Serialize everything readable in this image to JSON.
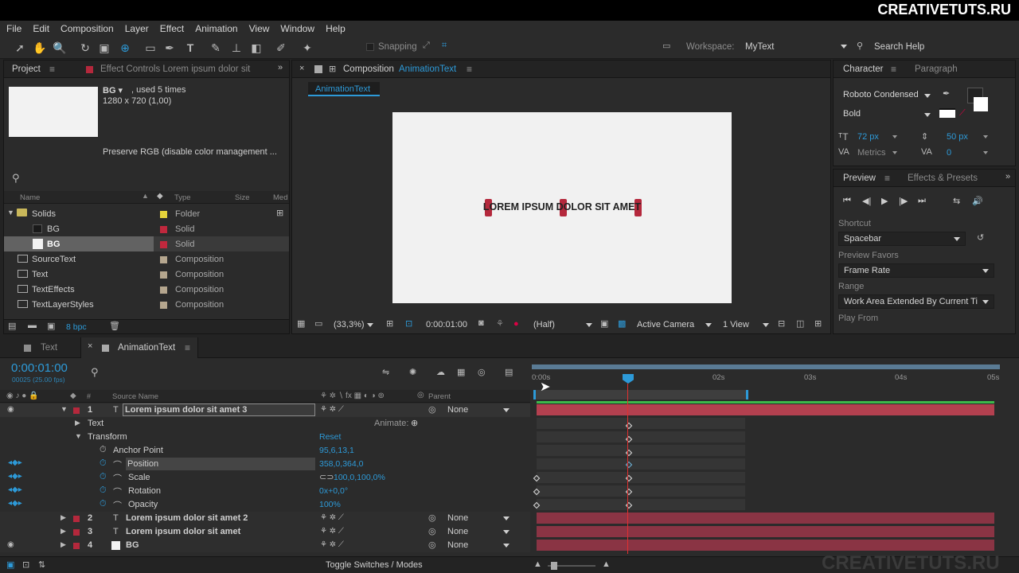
{
  "brand": "CREATIVETUTS.RU",
  "watermark": "CREATIVETUTS.RU",
  "menu": [
    "File",
    "Edit",
    "Composition",
    "Layer",
    "Effect",
    "Animation",
    "View",
    "Window",
    "Help"
  ],
  "toolbar": {
    "snapping": "Snapping",
    "workspace_label": "Workspace:",
    "workspace_value": "MyText",
    "search_help": "Search Help"
  },
  "project": {
    "tab": "Project",
    "effect_controls_tab": "Effect Controls Lorem ipsum dolor sit",
    "item_name": "BG ▾",
    "used": ", used 5 times",
    "dims": "1280 x 720 (1,00)",
    "preserve": "Preserve RGB (disable color management ...",
    "col_name": "Name",
    "col_type": "Type",
    "col_size": "Size",
    "col_med": "Med",
    "items": [
      {
        "name": "Solids",
        "type": "Folder",
        "color": "#e5d33b"
      },
      {
        "name": "BG",
        "type": "Solid",
        "color": "#c0283d"
      },
      {
        "name": "BG",
        "type": "Solid",
        "color": "#c0283d"
      },
      {
        "name": "SourceText",
        "type": "Composition",
        "color": "#b5a68e"
      },
      {
        "name": "Text",
        "type": "Composition",
        "color": "#b5a68e"
      },
      {
        "name": "TextEffects",
        "type": "Composition",
        "color": "#b5a68e"
      },
      {
        "name": "TextLayerStyles",
        "type": "Composition",
        "color": "#b5a68e"
      }
    ],
    "bpc": "8 bpc"
  },
  "comp": {
    "label": "Composition",
    "name": "AnimationText",
    "subtab": "AnimationText",
    "canvas_text": "LOREM IPSUM DOLOR SIT AMET",
    "zoom": "(33,3%)",
    "timecode": "0:00:01:00",
    "resolution": "(Half)",
    "camera": "Active Camera",
    "views": "1 View"
  },
  "character": {
    "tab": "Character",
    "tab2": "Paragraph",
    "font": "Roboto Condensed",
    "style": "Bold",
    "size": "72 px",
    "leading": "50 px",
    "kerning": "Metrics",
    "tracking": "0"
  },
  "preview": {
    "tab": "Preview",
    "tab2": "Effects & Presets",
    "shortcut_label": "Shortcut",
    "shortcut": "Spacebar",
    "favors_label": "Preview Favors",
    "favors": "Frame Rate",
    "range_label": "Range",
    "range": "Work Area Extended By Current Ti",
    "play_from": "Play From"
  },
  "timeline": {
    "tab_text": "Text",
    "tab_anim": "AnimationText",
    "timecode": "0:00:01:00",
    "fps": "00025 (25.00 fps)",
    "col_source": "Source Name",
    "col_parent": "Parent",
    "ruler": [
      "0:00s",
      "02s",
      "03s",
      "04s",
      "05s"
    ],
    "toggle": "Toggle Switches / Modes",
    "layers": [
      {
        "num": "1",
        "name": "Lorem ipsum dolor sit amet 3",
        "parent": "None"
      },
      {
        "num": "2",
        "name": "Lorem ipsum dolor sit amet 2",
        "parent": "None"
      },
      {
        "num": "3",
        "name": "Lorem ipsum dolor sit amet",
        "parent": "None"
      },
      {
        "num": "4",
        "name": "BG",
        "parent": "None"
      }
    ],
    "props": {
      "text": "Text",
      "animate": "Animate:",
      "transform": "Transform",
      "reset": "Reset",
      "anchor": "Anchor Point",
      "anchor_val": "95,6,13,1",
      "position": "Position",
      "position_val": "358,0,364,0",
      "scale": "Scale",
      "scale_val": "100,0,100,0%",
      "rotation": "Rotation",
      "rotation_val": "0x+0,0°",
      "opacity": "Opacity",
      "opacity_val": "100%"
    }
  }
}
